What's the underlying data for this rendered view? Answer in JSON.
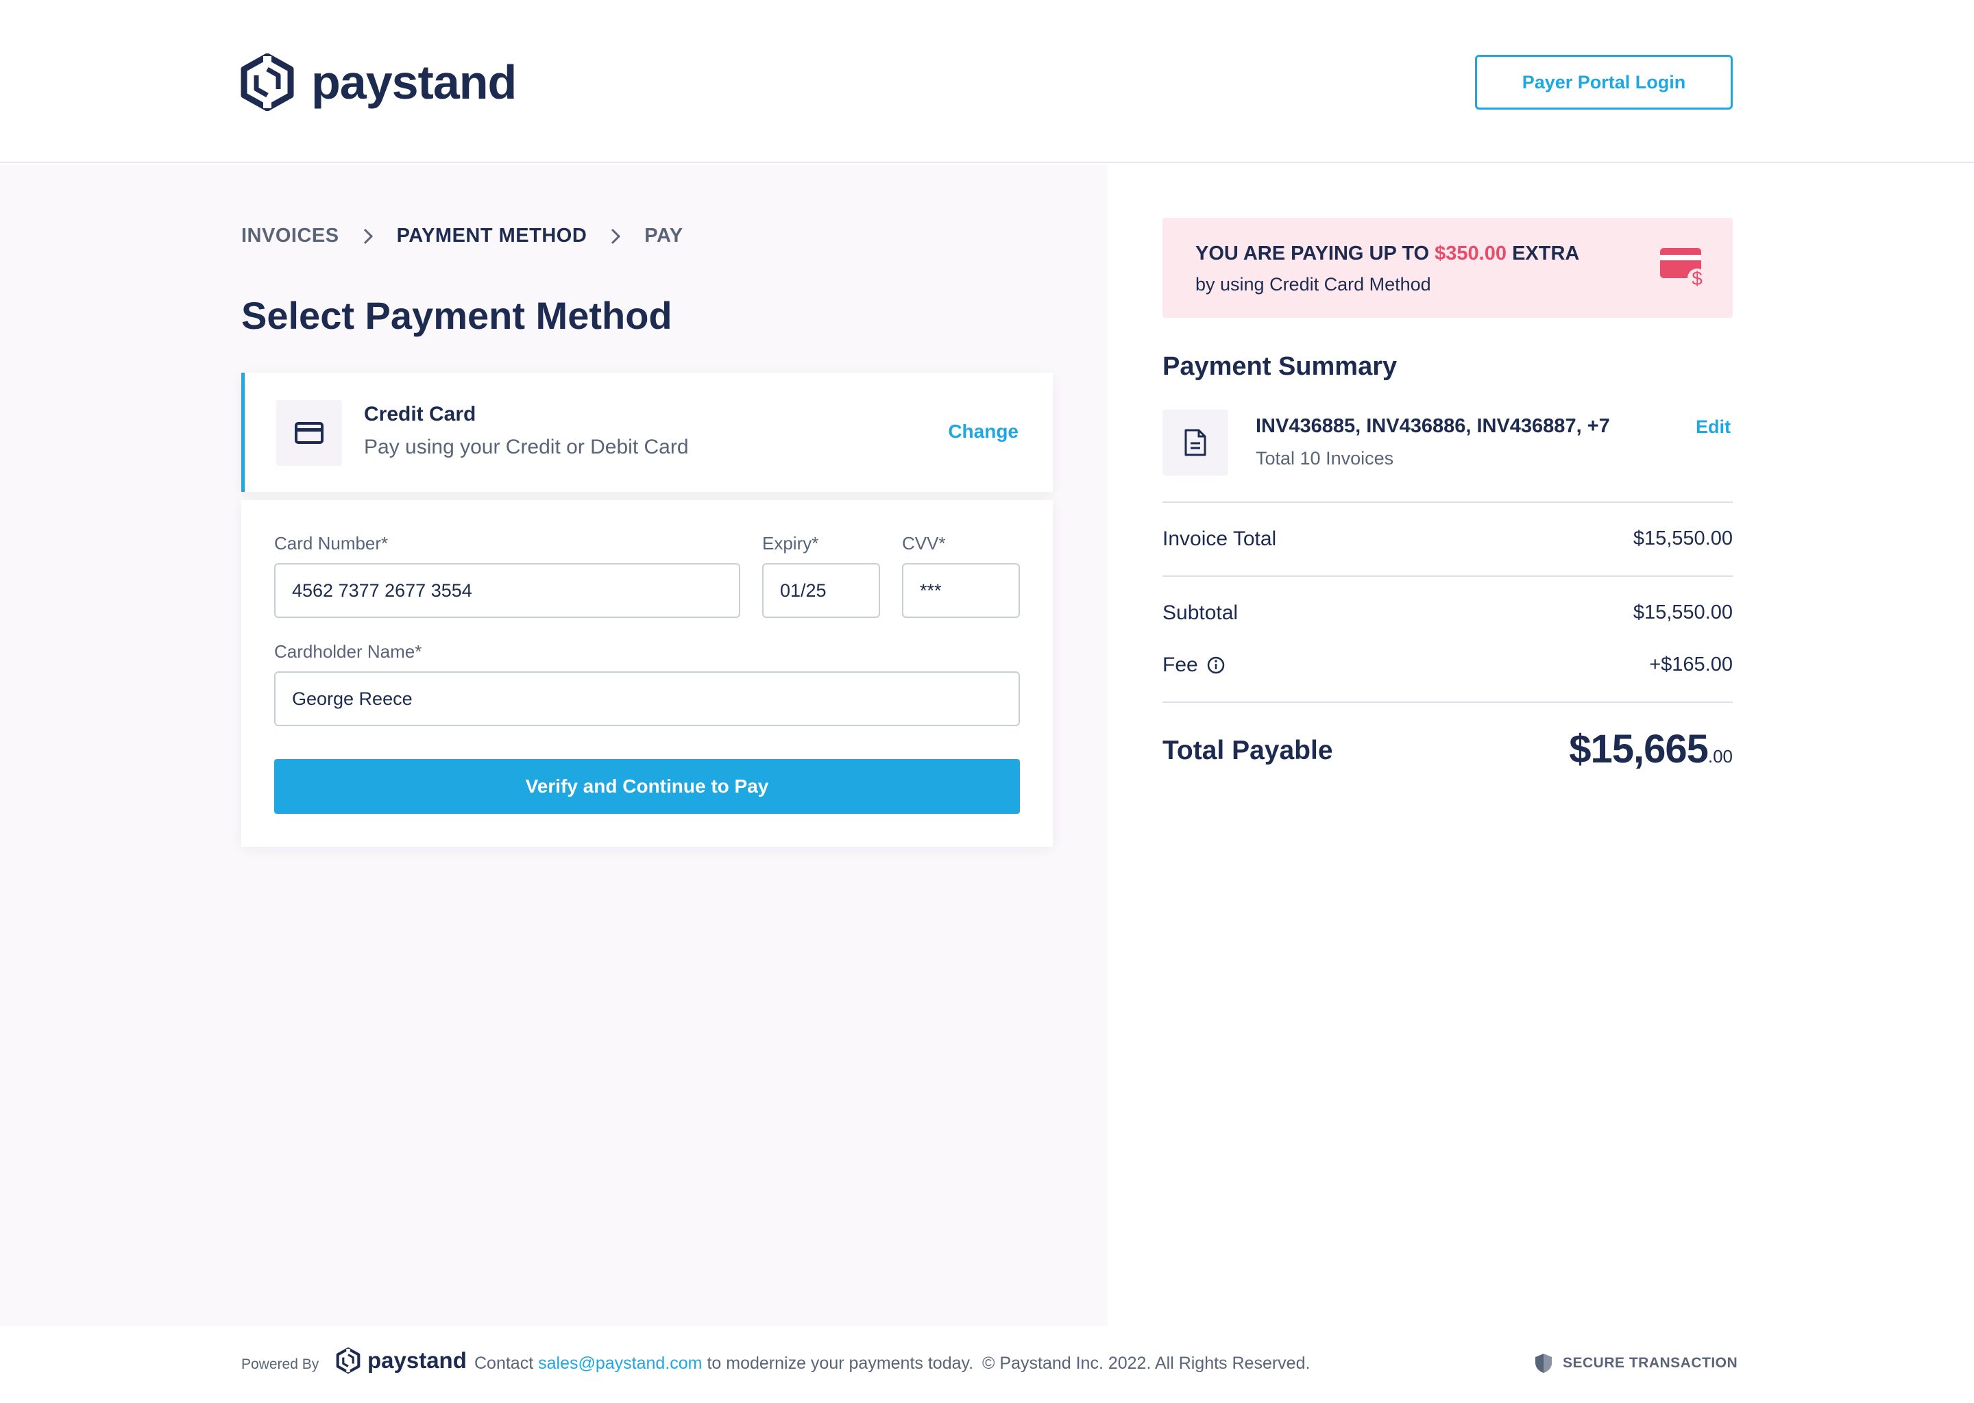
{
  "brand": {
    "name": "paystand",
    "logo_icon": "paystand-hexagon-icon"
  },
  "header": {
    "portal_login_label": "Payer Portal Login"
  },
  "breadcrumb": {
    "items": [
      "INVOICES",
      "PAYMENT METHOD",
      "PAY"
    ],
    "active_index": 1,
    "separator_icon": "chevron-right-icon"
  },
  "page_title": "Select Payment Method",
  "payment_method": {
    "icon": "credit-card-icon",
    "title": "Credit Card",
    "subtitle": "Pay using your Credit or Debit Card",
    "change_label": "Change"
  },
  "form": {
    "card_number": {
      "label": "Card Number*",
      "value": "4562 7377 2677 3554"
    },
    "expiry": {
      "label": "Expiry*",
      "value": "01/25"
    },
    "cvv": {
      "label": "CVV*",
      "value": "***"
    },
    "cardholder": {
      "label": "Cardholder Name*",
      "value": "George Reece"
    },
    "submit_label": "Verify and Continue to Pay"
  },
  "extra_notice": {
    "prefix": "YOU ARE PAYING UP TO",
    "amount": "$350.00",
    "suffix": "EXTRA",
    "detail": "by using Credit Card Method",
    "icon": "credit-card-dollar-icon"
  },
  "summary": {
    "title": "Payment Summary",
    "invoices": "INV436885, INV436886, INV436887, +7",
    "invoice_count": "Total 10 Invoices",
    "edit_label": "Edit",
    "invoice_total_label": "Invoice Total",
    "invoice_total_value": "$15,550.00",
    "subtotal_label": "Subtotal",
    "subtotal_value": "$15,550.00",
    "fee_label": "Fee",
    "fee_value": "+$165.00",
    "total_label": "Total Payable",
    "total_main": "$15,665",
    "total_cents": ".00"
  },
  "footer": {
    "powered_by": "Powered By",
    "contact_prefix": "Contact",
    "contact_email": "sales@paystand.com",
    "contact_suffix": "to modernize your payments today.",
    "copyright": "© Paystand Inc. 2022. All Rights Reserved.",
    "secure_label": "SECURE TRANSACTION"
  },
  "colors": {
    "primary": "#1ea7e0",
    "navy": "#1c2b4f",
    "alert_bg": "#fde8ee",
    "alert_accent": "#e94b6a"
  }
}
